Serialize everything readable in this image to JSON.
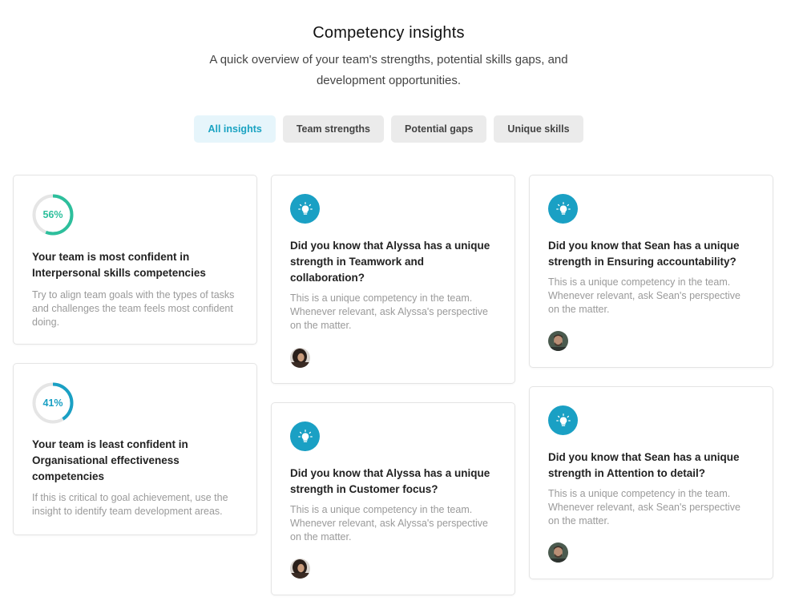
{
  "header": {
    "title": "Competency insights",
    "subtitle": "A quick overview of your team's strengths, potential skills gaps, and development opportunities."
  },
  "tabs": [
    {
      "label": "All insights",
      "active": true
    },
    {
      "label": "Team strengths",
      "active": false
    },
    {
      "label": "Potential gaps",
      "active": false
    },
    {
      "label": "Unique skills",
      "active": false
    }
  ],
  "colors": {
    "accent": "#1aa0c4",
    "progress_high": "#2dbf9c",
    "progress_low": "#1aa0c4",
    "ring_track": "#e5e5e5"
  },
  "insights": {
    "most_confident": {
      "progress": 0.56,
      "percent_label": "56%",
      "title": "Your team is most confident in Interpersonal skills competencies",
      "text": "Try to align team goals with the types of tasks and challenges the team feels most confident doing."
    },
    "least_confident": {
      "progress": 0.41,
      "percent_label": "41%",
      "title": "Your team is least confident in Organisational effectiveness competencies",
      "text": "If this is critical to goal achievement, use the insight to identify team development areas."
    },
    "alyssa_teamwork": {
      "icon": "lightbulb-icon",
      "title": "Did you know that Alyssa has a unique strength in Teamwork and collaboration?",
      "text": "This is a unique competency in the team. Whenever relevant, ask Alyssa's perspective on the matter."
    },
    "alyssa_customer": {
      "icon": "lightbulb-icon",
      "title": "Did you know that Alyssa has a unique strength in Customer focus?",
      "text": "This is a unique competency in the team. Whenever relevant, ask Alyssa's perspective on the matter."
    },
    "sean_accountability": {
      "icon": "lightbulb-icon",
      "title": "Did you know that Sean has a unique strength in Ensuring accountability?",
      "text": "This is a unique competency in the team. Whenever relevant, ask Sean's perspective on the matter."
    },
    "sean_detail": {
      "icon": "lightbulb-icon",
      "title": "Did you know that Sean has a unique strength in Attention to detail?",
      "text": "This is a unique competency in the team. Whenever relevant, ask Sean's perspective on the matter."
    }
  }
}
